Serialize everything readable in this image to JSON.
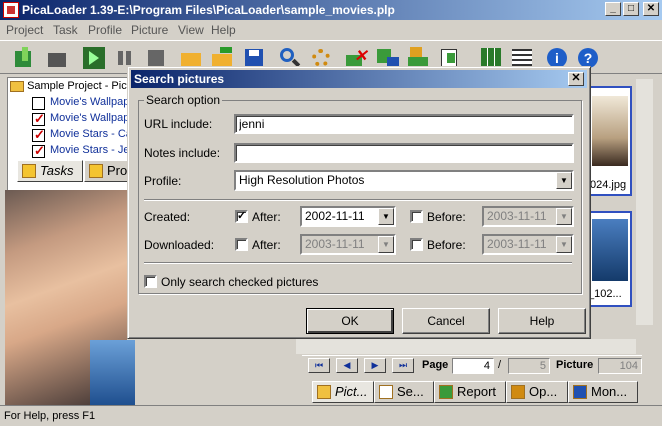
{
  "app": {
    "title": "PicaLoader 1.39-E:\\Program Files\\PicaLoader\\sample_movies.plp",
    "min": "_",
    "max": "□",
    "close": "✕"
  },
  "menu": [
    "Project",
    "Task",
    "Profile",
    "Picture",
    "View",
    "Help"
  ],
  "tree": {
    "root": "Sample Project - Pict",
    "items": [
      {
        "label": "Movie's Wallpape",
        "checked": false
      },
      {
        "label": "Movie's Wallpape",
        "checked": true
      },
      {
        "label": "Movie Stars - Ca",
        "checked": true
      },
      {
        "label": "Movie Stars - Je",
        "checked": true
      }
    ]
  },
  "left_tabs": {
    "tasks": "Tasks",
    "profiles": "Pro"
  },
  "thumbs": {
    "first_caption": "024.jpg",
    "second_caption": "_102..."
  },
  "pager": {
    "page_label": "Page",
    "page_value": "4",
    "sep": "/",
    "page_total": "5",
    "picture_label": "Picture",
    "picture_total": "104",
    "first": "⏮",
    "prev": "◀",
    "next": "▶",
    "last": "⏭"
  },
  "bottom_tabs": [
    "Pict...",
    "Se...",
    "Report",
    "Op...",
    "Mon..."
  ],
  "status": "For Help, press F1",
  "dialog": {
    "title": "Search pictures",
    "close": "✕",
    "group_label": "Search option",
    "url_label": "URL include:",
    "url_value": "jenni",
    "notes_label": "Notes include:",
    "notes_value": "",
    "profile_label": "Profile:",
    "profile_value": "High Resolution Photos",
    "created_label": "Created:",
    "downloaded_label": "Downloaded:",
    "after_label": "After:",
    "before_label": "Before:",
    "created_after_checked": true,
    "created_after_value": "2002-11-11",
    "created_before_checked": false,
    "created_before_value": "2003-11-11",
    "downloaded_after_checked": false,
    "downloaded_after_value": "2003-11-11",
    "downloaded_before_checked": false,
    "downloaded_before_value": "2003-11-11",
    "only_checked_label": "Only search checked pictures",
    "only_checked": false,
    "ok": "OK",
    "cancel": "Cancel",
    "help": "Help"
  },
  "icons": [
    "new-project-icon",
    "open-project-icon",
    "start-icon",
    "pause-icon",
    "stop-icon",
    "open-folder-icon",
    "export-icon",
    "save-icon",
    "search-icon",
    "settings-icon",
    "delete-icon",
    "download-icon",
    "upload-icon",
    "properties-icon",
    "thumbnails-view-icon",
    "details-view-icon",
    "info-icon",
    "help-icon"
  ],
  "colors": {
    "title_start": "#0a246a",
    "title_end": "#a6caf0",
    "face": "#d4d0c8",
    "link": "#10309a"
  }
}
